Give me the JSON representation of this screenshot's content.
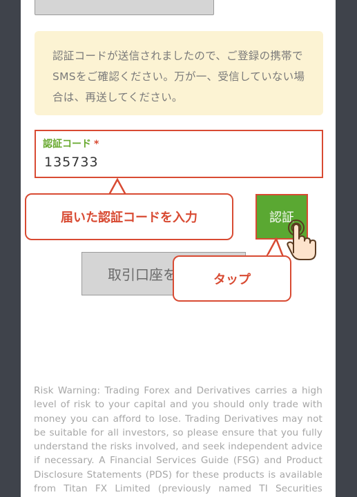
{
  "notice": {
    "message": "認証コードが送信されましたので、ご登録の携帯でSMSをご確認ください。万が一、受信していない場合は、再送してください。"
  },
  "verification": {
    "label": "認証コード",
    "required_mark": "*",
    "value": "135733"
  },
  "buttons": {
    "verify_label": "認証",
    "open_account_label": "取引口座を"
  },
  "callouts": {
    "enter_code": "届いた認証コードを入力",
    "tap": "タップ"
  },
  "risk_warning": "Risk Warning: Trading Forex and Derivatives carries a high level of risk to your capital and you should only trade with money you can afford to lose. Trading Derivatives may not be suitable for all investors, so please ensure that you fully understand the risks involved, and seek independent advice if necessary. A Financial Services Guide (FSG) and Product Disclosure Statements (PDS) for these products is available from Titan FX Limited (previously named TI Securities Limited) to download",
  "colors": {
    "accent_red": "#d84a32",
    "verify_green": "#5aa832",
    "label_green": "#66a82c",
    "notice_bg": "#fcf3d3"
  },
  "icons": {
    "pointer": "tap-hand-icon"
  }
}
